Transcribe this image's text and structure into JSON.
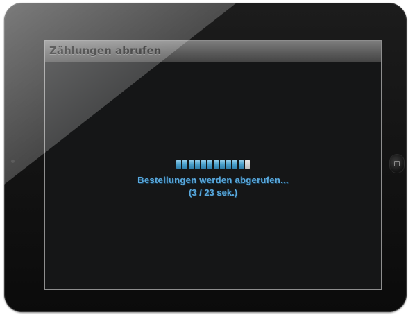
{
  "window": {
    "title": "Zählungen abrufen"
  },
  "loading": {
    "message": "Bestellungen werden abgerufen...",
    "timer": "(3 / 23 sek.)",
    "progress_segments_total": 12,
    "progress_segments_filled": 11
  },
  "icons": {
    "home_button": "home-button-icon",
    "camera": "camera-icon"
  },
  "colors": {
    "accent": "#5aa8dc",
    "progress_filled": "#4aa1cc",
    "progress_empty": "#e0e0e0",
    "screen_background": "#151617",
    "header_background": "#6a6a6a"
  }
}
